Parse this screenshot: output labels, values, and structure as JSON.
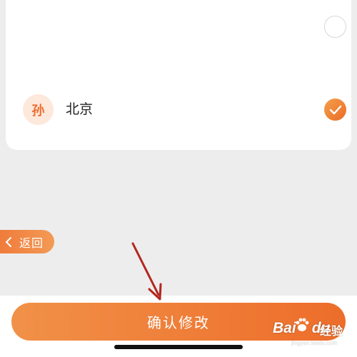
{
  "city_option": {
    "avatar_char": "孙",
    "label": "北京",
    "selected": true
  },
  "nav": {
    "back_label": "返回",
    "back_icon": "chevron-left-icon"
  },
  "confirm_button": {
    "label": "确认修改"
  },
  "watermark": {
    "brand": "Bai",
    "brand_tail": "du",
    "sub": "经验",
    "url": "jingyan.baidu.com"
  },
  "colors": {
    "accent": "#ee6c2d",
    "accent_light": "#f39a55",
    "avatar_bg": "#fde8dc",
    "background": "#ededed",
    "annotation_arrow": "#b3261e"
  }
}
